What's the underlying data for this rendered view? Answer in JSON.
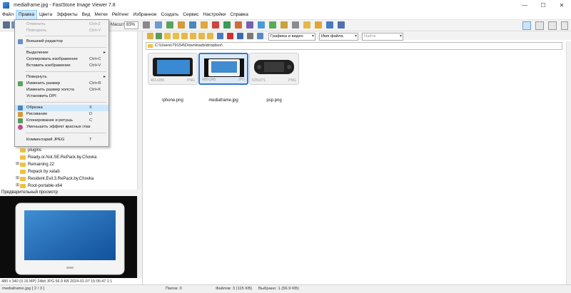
{
  "window": {
    "title": "mediaframe.jpg - FastStone Image Viewer 7.8",
    "min": "—",
    "max": "☐",
    "close": "✕"
  },
  "menubar": [
    "Файл",
    "Правка",
    "Цвета",
    "Эффекты",
    "Вид",
    "Метки",
    "Рейтинг",
    "Избранное",
    "Создать",
    "Сервис",
    "Настройки",
    "Справка"
  ],
  "toolbar": {
    "zoom_label": "Масшт.",
    "zoom_value": "83%",
    "sort_filter": "Графика и видео",
    "sort_by": "Имя файла",
    "search_placeholder": "Найти"
  },
  "edit_menu": {
    "undo": {
      "label": "Отменить",
      "shortcut": "Ctrl+Z"
    },
    "redo": {
      "label": "Повторить",
      "shortcut": "Ctrl+Y"
    },
    "external_editor": {
      "label": "Внешний редактор"
    },
    "select": {
      "label": "Выделение"
    },
    "copy_image": {
      "label": "Скопировать изображение",
      "shortcut": "Ctrl+C"
    },
    "paste_image": {
      "label": "Вставить изображение",
      "shortcut": "Ctrl+V"
    },
    "rotate": {
      "label": "Повернуть"
    },
    "resize": {
      "label": "Изменить размер",
      "shortcut": "Ctrl+R"
    },
    "canvas_size": {
      "label": "Изменить размер холста",
      "shortcut": "Ctrl+K"
    },
    "set_dpi": {
      "label": "Установить DPI"
    },
    "crop": {
      "label": "Обрезка",
      "shortcut": "X"
    },
    "draw": {
      "label": "Рисование",
      "shortcut": "D"
    },
    "clone_heal": {
      "label": "Клонирование и ретушь",
      "shortcut": "C"
    },
    "red_eye": {
      "label": "Уменьшить эффект красных глаз"
    },
    "jpeg_comment": {
      "label": "Комментарий JPEG",
      "shortcut": "T"
    }
  },
  "tree": [
    "plugins",
    "Ready.or.Not.SE.RePack.by.Chovka",
    "Remaining 22",
    "Repack by xatab",
    "Resident.Evil.3.RePack.by.Chovka",
    "Root-portable-x64"
  ],
  "preview": {
    "title": "Предварительный просмотр",
    "status": "480 x 340 (0.16 MP)  24bit  JPG   56.9 KB   2024-01-07 15:05:47  1:1",
    "file_info": "mediaframe.jpg [ 2 / 3 ]"
  },
  "path": "C:\\Users\\79154\\Downloads\\dropbox\\",
  "thumbnails": [
    {
      "name": "iphone.png",
      "dims": "461x286",
      "type": "PNG"
    },
    {
      "name": "mediaframe.jpg",
      "dims": "480x340",
      "type": "JPG"
    },
    {
      "name": "psp.png",
      "dims": "525x271",
      "type": "PNG"
    }
  ],
  "status": {
    "folders": "Папок: 0",
    "files": "Файлов: 3 (115 KB)",
    "selected": "Выбрано: 1 (56.9 KB)"
  },
  "colors": {
    "accent": "#3a78c8",
    "menu_highlight": "#cce8ff",
    "folder": "#f0c040"
  }
}
